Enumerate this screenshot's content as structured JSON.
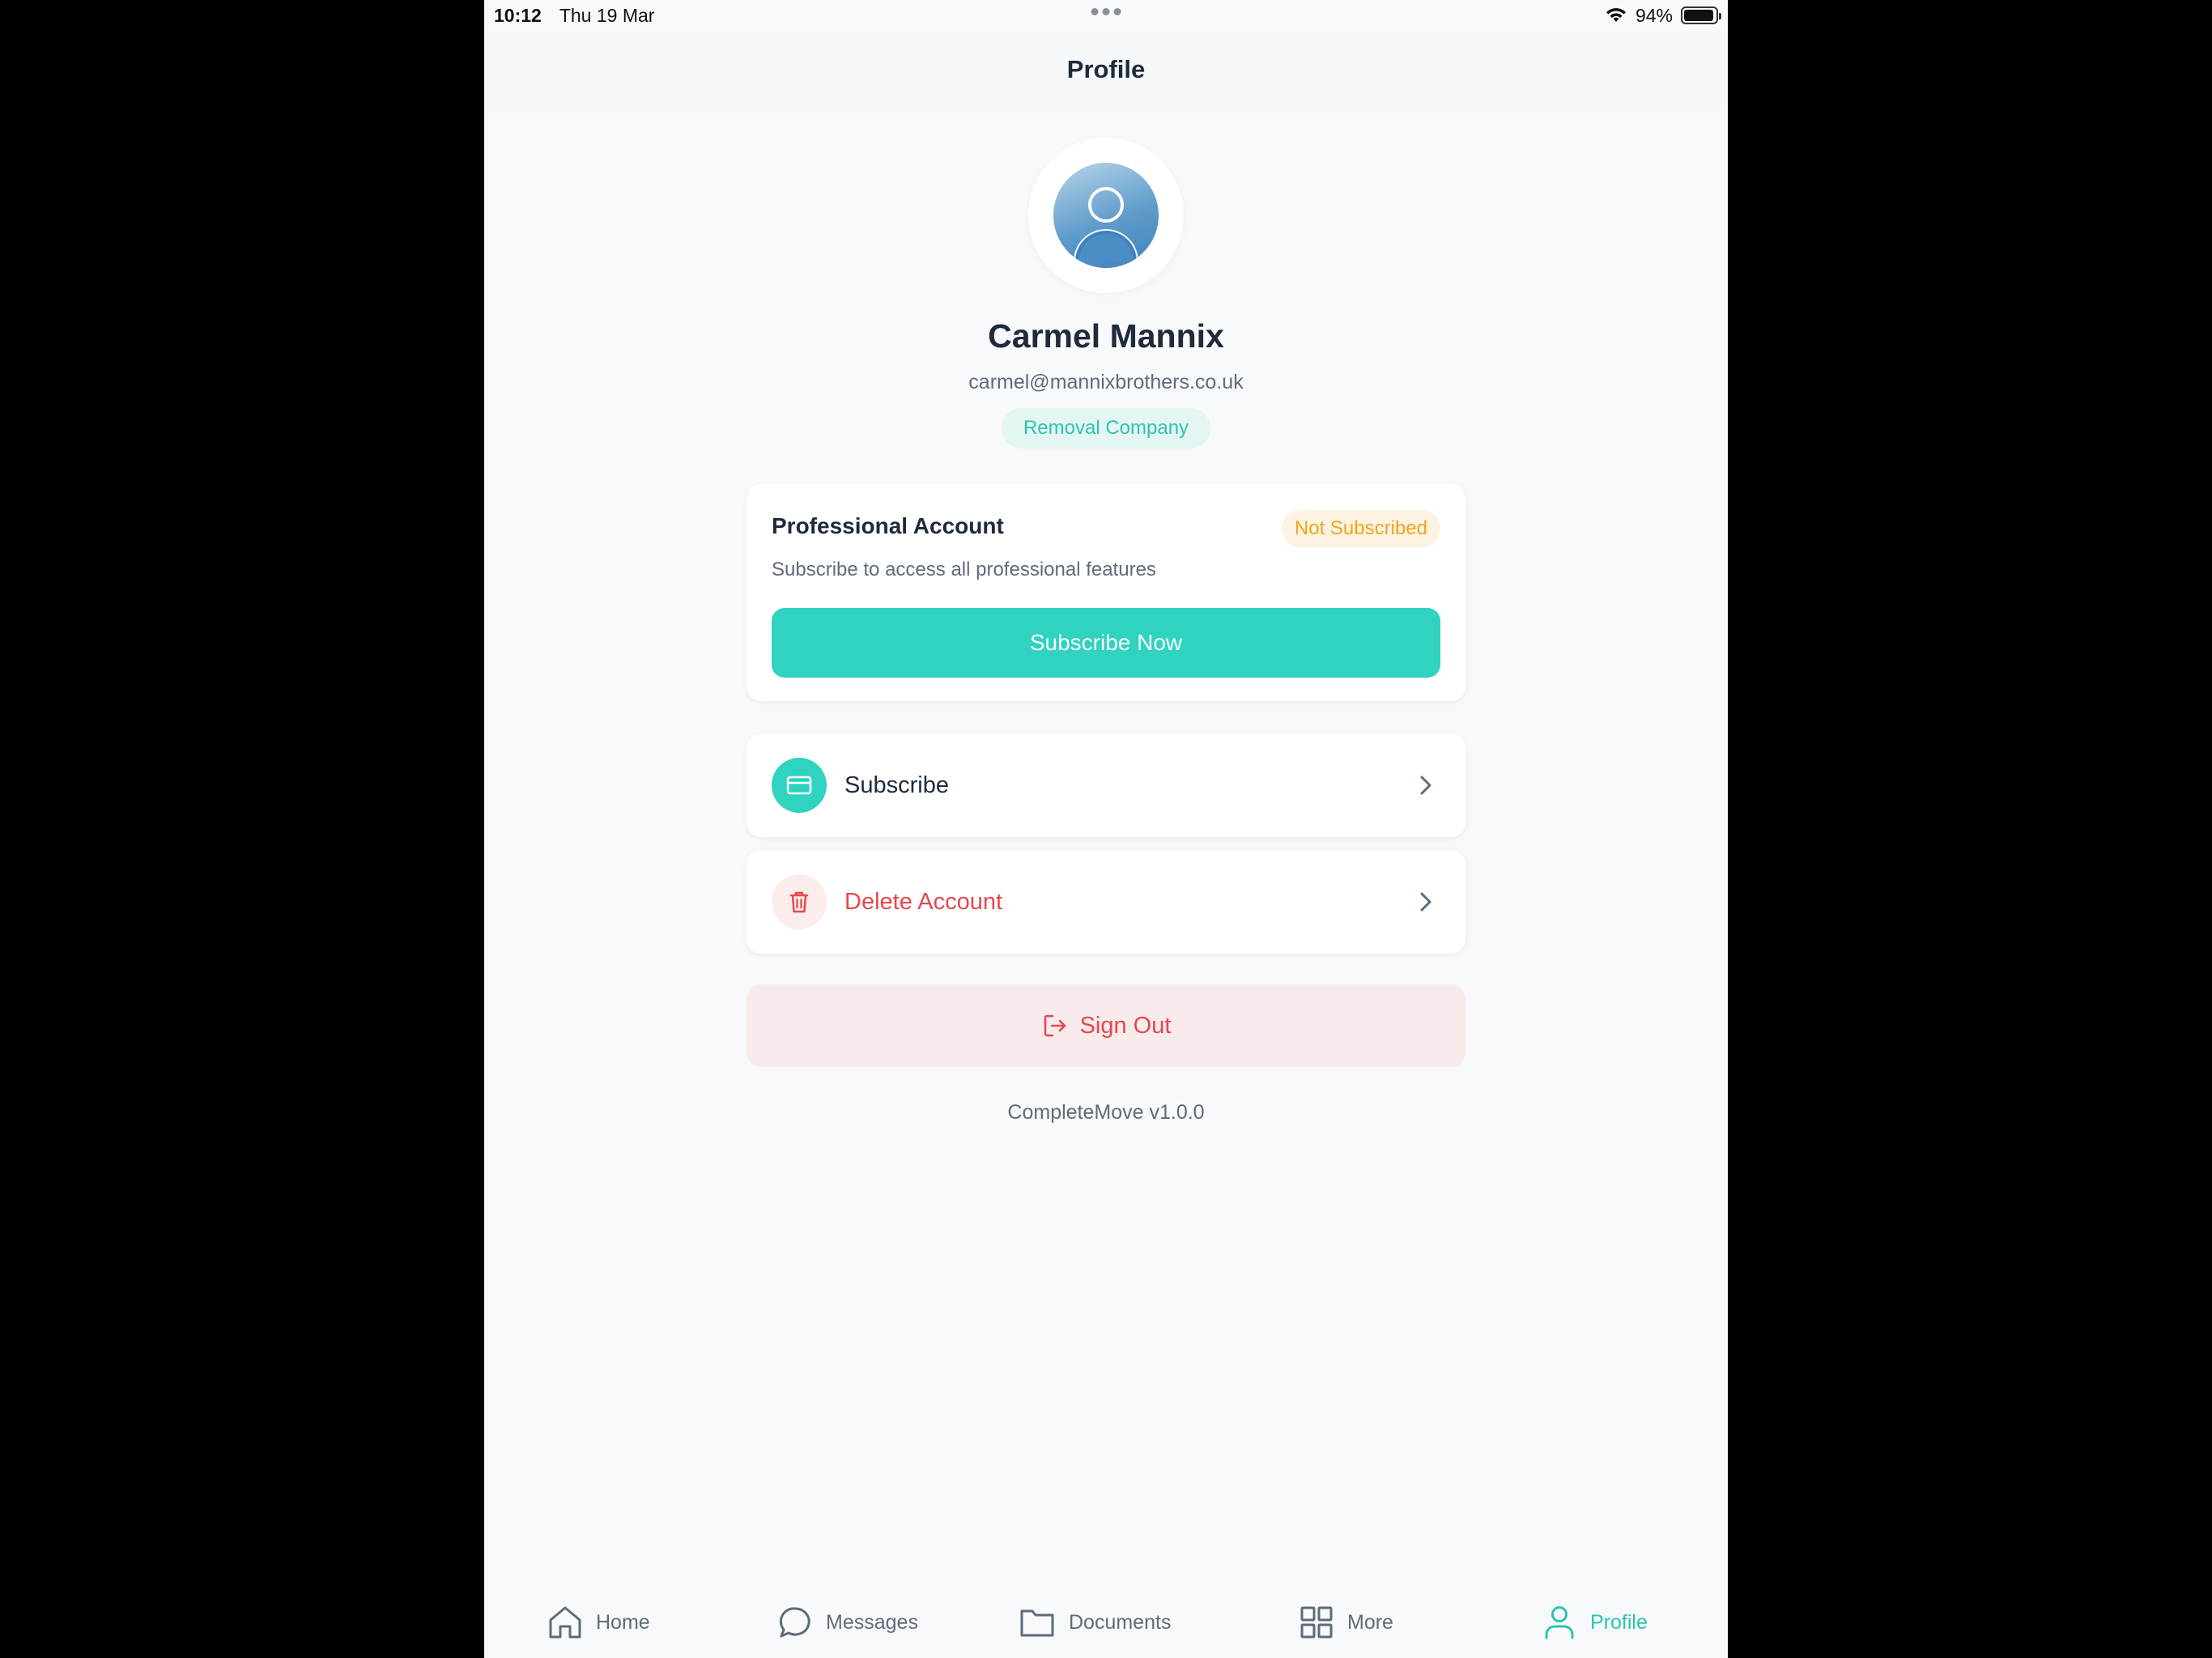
{
  "status_bar": {
    "time": "10:12",
    "date": "Thu 19 Mar",
    "battery": "94%"
  },
  "header": {
    "title": "Profile"
  },
  "profile": {
    "name": "Carmel Mannix",
    "email": "carmel@mannixbrothers.co.uk",
    "role": "Removal Company"
  },
  "pro_card": {
    "title": "Professional Account",
    "status": "Not Subscribed",
    "description": "Subscribe to access all professional features",
    "button": "Subscribe Now"
  },
  "menu": {
    "subscribe": "Subscribe",
    "delete_account": "Delete Account"
  },
  "sign_out": "Sign Out",
  "version": "CompleteMove v1.0.0",
  "tabs": [
    {
      "label": "Home",
      "icon": "home-icon"
    },
    {
      "label": "Messages",
      "icon": "chat-bubble-icon"
    },
    {
      "label": "Documents",
      "icon": "folder-icon"
    },
    {
      "label": "More",
      "icon": "grid-icon"
    },
    {
      "label": "Profile",
      "icon": "person-icon",
      "active": true
    }
  ],
  "colors": {
    "accent": "#2fd3c0",
    "danger": "#e5484d",
    "warning": "#f0a51a",
    "text": "#1f2a3a",
    "muted": "#5f6b7a",
    "background": "#f7f9fb"
  },
  "battery_level": 0.94
}
